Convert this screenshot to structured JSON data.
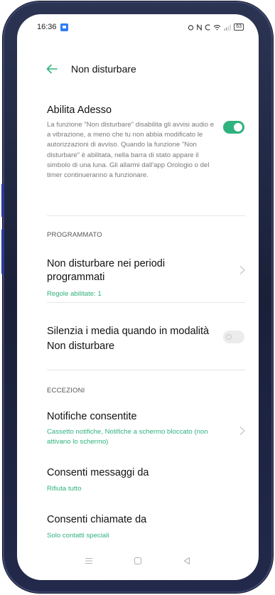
{
  "status_bar": {
    "time": "16:36",
    "app_icon": "gallery-icon",
    "status_icons": [
      "alarm-icon",
      "nfc-icon",
      "call-icon",
      "wifi-icon",
      "signal-icon"
    ],
    "battery": "63"
  },
  "header": {
    "back_icon": "arrow-left-icon",
    "title": "Non disturbare"
  },
  "enable_now": {
    "title": "Abilita Adesso",
    "description": "La funzione \"Non disturbare\" disabilita gli avvisi audio e a vibrazione, a meno che tu non abbia modificato le autorizzazioni di avviso. Quando la funzione \"Non disturbare\" è abilitata, nella barra di stato appare il simbolo di una luna. Gli allarmi dall'app Orologio o del timer continueranno a funzionare.",
    "toggle_on": true
  },
  "scheduled": {
    "section_label": "PROGRAMMATO",
    "title": "Non disturbare nei periodi programmati",
    "subtitle": "Regole abilitate: 1"
  },
  "mute_media": {
    "title": "Silenzia i media quando in modalità Non disturbare",
    "toggle_on": false
  },
  "exceptions": {
    "section_label": "ECCEZIONI",
    "allowed_notifications": {
      "title": "Notifiche consentite",
      "subtitle": "Cassetto notifiche, Notifiche a schermo bloccato (non attivano lo schermo)"
    },
    "allow_messages": {
      "title": "Consenti messaggi da",
      "subtitle": "Rifiuta tutto"
    },
    "allow_calls": {
      "title": "Consenti chiamate da",
      "subtitle": "Solo contatti speciali"
    }
  },
  "nav_bar": [
    "menu-icon",
    "home-icon",
    "back-triangle-icon"
  ],
  "colors": {
    "accent": "#2fb27e",
    "bezel": "#1a2038",
    "text_primary": "#111111",
    "text_secondary": "#7a7a7a"
  }
}
